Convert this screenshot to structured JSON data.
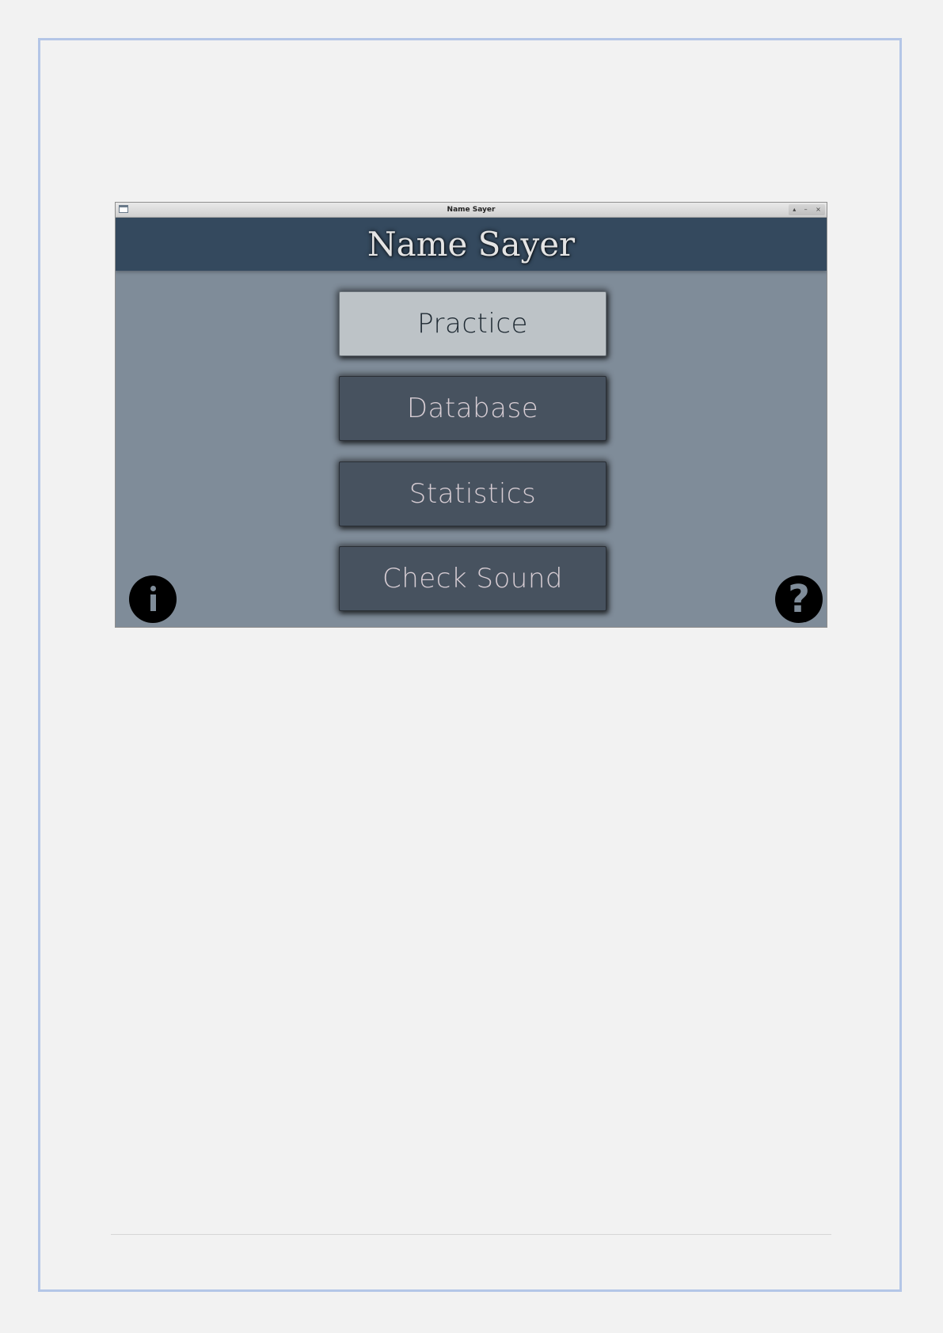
{
  "window": {
    "title": "Name Sayer",
    "controls": [
      "▴",
      "–",
      "×"
    ]
  },
  "header": {
    "title": "Name Sayer"
  },
  "menu": {
    "practice_label": "Practice",
    "database_label": "Database",
    "statistics_label": "Statistics",
    "check_sound_label": "Check Sound"
  },
  "icons": {
    "info": "info-icon",
    "help": "help-icon",
    "help_glyph": "?"
  },
  "colors": {
    "page_background": "#f2f2f2",
    "page_border": "#b4c6e7",
    "header_background": "#34495e",
    "body_background": "#7f8c99",
    "button_background": "#47525f",
    "selected_button_background": "#bdc3c7",
    "button_text": "#d6ccd3"
  }
}
